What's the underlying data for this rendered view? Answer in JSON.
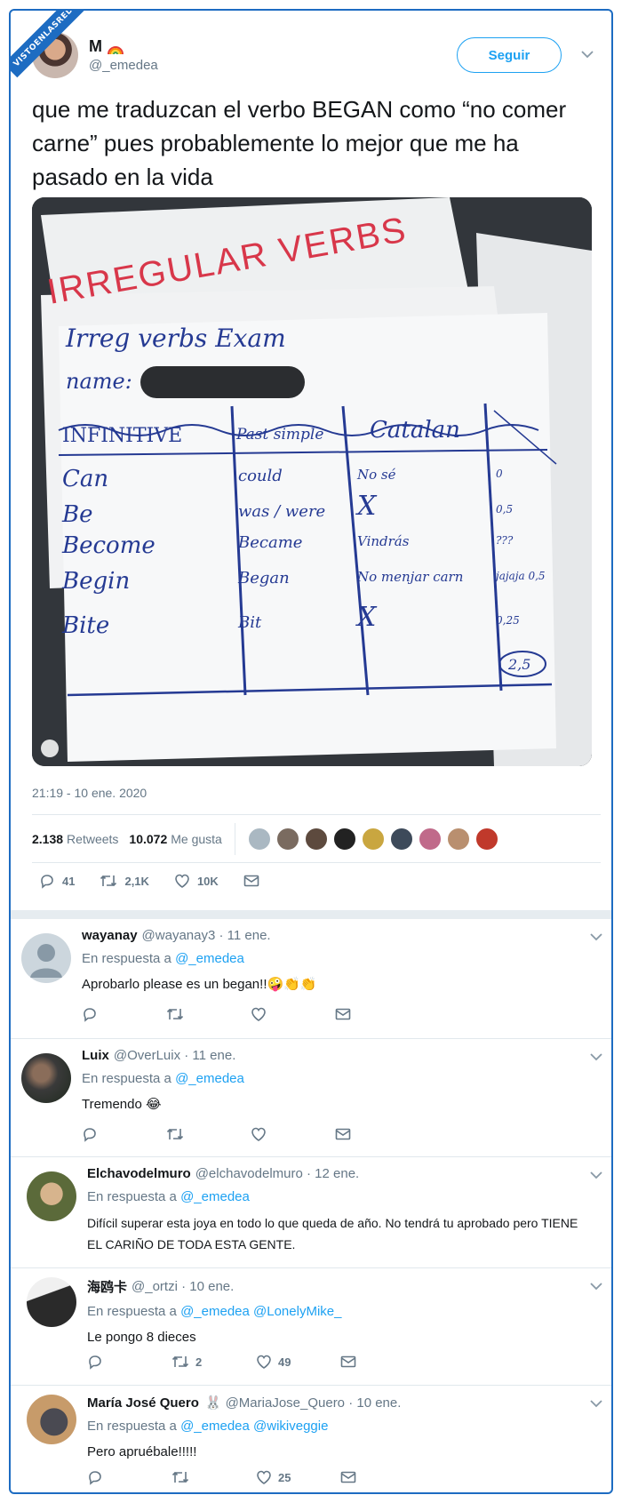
{
  "watermark": "VISTOENLASREDES",
  "author": {
    "display_name": "M",
    "handle": "@_emedea"
  },
  "follow_label": "Seguir",
  "tweet_text": "que me traduzcan el verbo BEGAN como “no comer carne” pues probablemente lo mejor que me ha pasado en la vida",
  "photo": {
    "header_text": "IRREGULAR VERBS",
    "title": "Irreg verbs Exam",
    "name_label": "name:",
    "columns": [
      "INFINITIVE",
      "Past simple",
      "Catalan"
    ],
    "rows": [
      {
        "infinitive": "Can",
        "past": "could",
        "catalan": "No sé",
        "score": "0"
      },
      {
        "infinitive": "Be",
        "past": "was / were",
        "catalan": "X",
        "score": "0,5"
      },
      {
        "infinitive": "Become",
        "past": "Became",
        "catalan": "Vindrás",
        "score": "???"
      },
      {
        "infinitive": "Begin",
        "past": "Began",
        "catalan": "No menjar carn",
        "score": "jajaja 0,5"
      },
      {
        "infinitive": "Bite",
        "past": "Bit",
        "catalan": "X",
        "score": "0,25"
      }
    ],
    "total": "2,5"
  },
  "timestamp": "21:19 - 10 ene. 2020",
  "stats": {
    "retweets_count": "2.138",
    "retweets_label": "Retweets",
    "likes_count": "10.072",
    "likes_label": "Me gusta"
  },
  "main_actions": {
    "replies": "41",
    "retweets": "2,1K",
    "likes": "10K"
  },
  "colors": {
    "accent": "#1da1f2",
    "frame": "#1d6cc2",
    "secondary_text": "#657786"
  },
  "replies": [
    {
      "name": "wayanay",
      "handle": "@wayanay3 · 11 ene.",
      "in_reply_prefix": "En respuesta a",
      "in_reply_to": "@_emedea",
      "text": "Aprobarlo please es un began!!🤪👏👏",
      "retweets": "",
      "likes": ""
    },
    {
      "name": "Luix",
      "handle": "@OverLuix · 11 ene.",
      "in_reply_prefix": "En respuesta a",
      "in_reply_to": "@_emedea",
      "text": "Tremendo 😂",
      "retweets": "",
      "likes": ""
    },
    {
      "name": "Elchavodelmuro",
      "handle": "@elchavodelmuro · 12 ene.",
      "in_reply_prefix": "En respuesta a",
      "in_reply_to": "@_emedea",
      "text": "Difícil superar esta joya en todo lo que queda de año. No tendrá tu aprobado pero TIENE EL CARIÑO DE TODA ESTA GENTE.",
      "retweets": "",
      "likes": ""
    },
    {
      "name": "海鸥卡",
      "handle": "@_ortzi · 10 ene.",
      "in_reply_prefix": "En respuesta a",
      "in_reply_to": "@_emedea @LonelyMike_",
      "text": "Le pongo 8 dieces",
      "retweets": "2",
      "likes": "49"
    },
    {
      "name": "María José Quero",
      "handle": "@MariaJose_Quero · 10 ene.",
      "in_reply_prefix": "En respuesta a",
      "in_reply_to": "@_emedea @wikiveggie",
      "text": "Pero apruébale!!!!!",
      "retweets": "",
      "likes": "25"
    }
  ]
}
